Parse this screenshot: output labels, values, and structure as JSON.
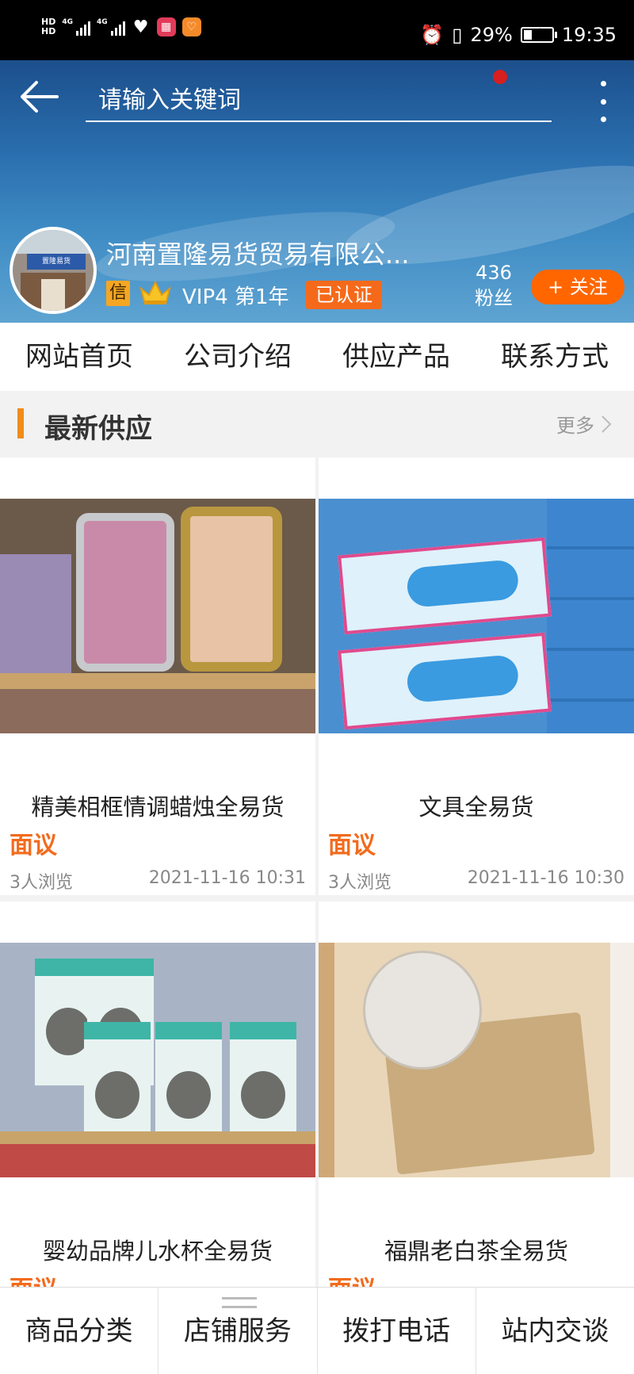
{
  "status_bar": {
    "hd1": "HD",
    "hd2": "HD",
    "net1": "4G",
    "net2": "4G",
    "battery_percent": "29%",
    "battery_level": 0.29,
    "time": "19:35",
    "icons": [
      "signal-icon",
      "heart-app-icon",
      "red-app-icon",
      "orange-app-icon",
      "alarm-icon",
      "vibrate-icon",
      "battery-charging-icon"
    ]
  },
  "header": {
    "search_placeholder": "请输入关键词",
    "notification_color": "#d71f1f"
  },
  "store": {
    "name": "河南置隆易货贸易有限公...",
    "credit_badge": "信",
    "vip_text": "VIP4 第1年",
    "verified_label": "已认证",
    "fans_count": "436",
    "fans_label": "粉丝",
    "follow_label": "+ 关注",
    "avatar_sign": "置隆易货"
  },
  "tabs": [
    {
      "label": "网站首页"
    },
    {
      "label": "公司介绍"
    },
    {
      "label": "供应产品"
    },
    {
      "label": "联系方式"
    }
  ],
  "section": {
    "title": "最新供应",
    "more_label": "更多",
    "accent": "#f08c1a"
  },
  "products": [
    {
      "title": "精美相框情调蜡烛全易货",
      "price": "面议",
      "views": "3人浏览",
      "date": "2021-11-16 10:31"
    },
    {
      "title": "文具全易货",
      "price": "面议",
      "views": "3人浏览",
      "date": "2021-11-16 10:30"
    },
    {
      "title": "婴幼品牌儿水杯全易货",
      "price": "面议",
      "views": "",
      "date": ""
    },
    {
      "title": "福鼎老白茶全易货",
      "price": "面议",
      "views": "",
      "date": ""
    }
  ],
  "bottom_bar": [
    {
      "label": "商品分类"
    },
    {
      "label": "店铺服务"
    },
    {
      "label": "拨打电话"
    },
    {
      "label": "站内交谈"
    }
  ],
  "colors": {
    "price": "#f26b1d",
    "follow_button": "#ff6600",
    "verified_badge": "#f56a1a"
  }
}
